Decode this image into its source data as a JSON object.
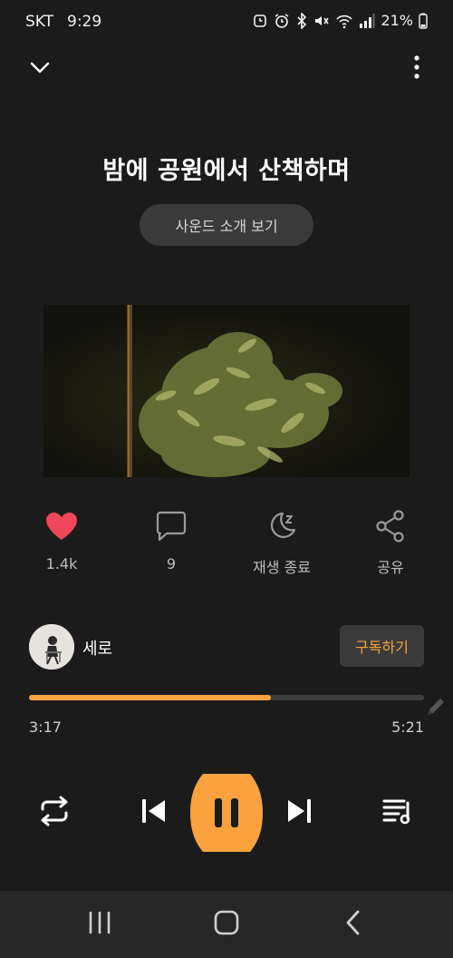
{
  "status_bar": {
    "carrier": "SKT",
    "time": "9:29",
    "battery": "21%"
  },
  "track": {
    "title": "밤에 공원에서 산책하며",
    "sound_intro_label": "사운드 소개 보기"
  },
  "actions": {
    "like_count": "1.4k",
    "comment_count": "9",
    "sleep_timer_label": "재생 종료",
    "share_label": "공유"
  },
  "channel": {
    "name": "세로",
    "subscribe_label": "구독하기"
  },
  "playback": {
    "current_time": "3:17",
    "total_time": "5:21",
    "progress_fraction": 0.613
  },
  "colors": {
    "accent": "#f9a23f",
    "like": "#f0475a",
    "background": "#1b1b1b"
  }
}
